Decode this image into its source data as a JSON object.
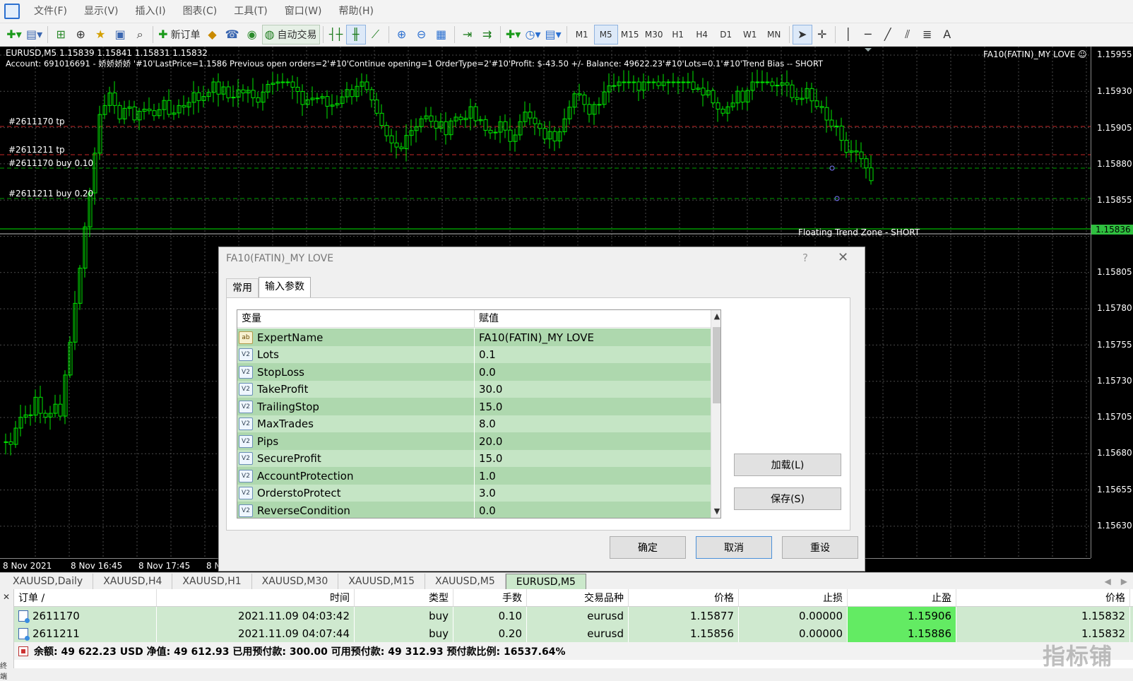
{
  "menu": [
    "文件(F)",
    "显示(V)",
    "插入(I)",
    "图表(C)",
    "工具(T)",
    "窗口(W)",
    "帮助(H)"
  ],
  "toolbar": {
    "new_order_label": "新订单",
    "auto_trade_label": "自动交易",
    "timeframes": [
      "M1",
      "M5",
      "M15",
      "M30",
      "H1",
      "H4",
      "D1",
      "W1",
      "MN"
    ],
    "selected_timeframe": "M5"
  },
  "chart": {
    "header": "EURUSD,M5  1.15839 1.15841 1.15831 1.15832",
    "info": "Account: 691016691 - 娇娇娇娇 '#10'LastPrice=1.1586 Previous open orders=2'#10'Continue opening=1 OrderType=2'#10'Profit: $-43.50 +/-  Balance: 49622.23'#10'Lots=0.1'#10'Trend Bias -- SHORT",
    "ea_label": "FA10(FATIN)_MY LOVE ☺",
    "line_labels": [
      "#2611170 tp",
      "#2611211 tp",
      "#2611170 buy 0.10",
      "#2611211 buy 0.20"
    ],
    "floating_label": "Floating Trend Zone - SHORT",
    "price_labels": [
      "1.15955",
      "1.15930",
      "1.15905",
      "1.15880",
      "1.15855",
      "1.15805",
      "1.15780",
      "1.15755",
      "1.15730",
      "1.15705",
      "1.15680",
      "1.15655",
      "1.15630"
    ],
    "current_price": "1.15836",
    "time_labels": [
      "8 Nov 2021",
      "8 Nov 16:45",
      "8 Nov 17:45",
      "8 N"
    ],
    "colors": {
      "candle": "#00e600",
      "tp_line": "#c62828",
      "entry_line": "#00a000",
      "background": "#000000"
    }
  },
  "dialog": {
    "title": "FA10(FATIN)_MY LOVE",
    "help": "?",
    "close": "✕",
    "tabs": [
      "常用",
      "输入参数"
    ],
    "active_tab": "输入参数",
    "columns": [
      "变量",
      "赋值"
    ],
    "params": [
      {
        "type": "ab",
        "name": "ExpertName",
        "value": "FA10(FATIN)_MY LOVE"
      },
      {
        "type": "v2",
        "name": "Lots",
        "value": "0.1"
      },
      {
        "type": "v2",
        "name": "StopLoss",
        "value": "0.0"
      },
      {
        "type": "v2",
        "name": "TakeProfit",
        "value": "30.0"
      },
      {
        "type": "v2",
        "name": "TrailingStop",
        "value": "15.0"
      },
      {
        "type": "v2",
        "name": "MaxTrades",
        "value": "8.0"
      },
      {
        "type": "v2",
        "name": "Pips",
        "value": "20.0"
      },
      {
        "type": "v2",
        "name": "SecureProfit",
        "value": "15.0"
      },
      {
        "type": "v2",
        "name": "AccountProtection",
        "value": "1.0"
      },
      {
        "type": "v2",
        "name": "OrderstoProtect",
        "value": "3.0"
      },
      {
        "type": "v2",
        "name": "ReverseCondition",
        "value": "0.0"
      }
    ],
    "load_button": "加载(L)",
    "save_button": "保存(S)",
    "ok_button": "确定",
    "cancel_button": "取消",
    "reset_button": "重设"
  },
  "chart_tabs": [
    "XAUUSD,Daily",
    "XAUUSD,H4",
    "XAUUSD,H1",
    "XAUUSD,M30",
    "XAUUSD,M15",
    "XAUUSD,M5",
    "EURUSD,M5"
  ],
  "active_chart_tab": "EURUSD,M5",
  "terminal": {
    "columns": [
      "订单 /",
      "时间",
      "类型",
      "手数",
      "交易品种",
      "价格",
      "止损",
      "止盈",
      "价格"
    ],
    "orders": [
      [
        "2611170",
        "2021.11.09 04:03:42",
        "buy",
        "0.10",
        "eurusd",
        "1.15877",
        "0.00000",
        "1.15906",
        "1.15832"
      ],
      [
        "2611211",
        "2021.11.09 04:07:44",
        "buy",
        "0.20",
        "eurusd",
        "1.15856",
        "0.00000",
        "1.15886",
        "1.15832"
      ]
    ],
    "summary": "余额: 49 622.23 USD  净值: 49 612.93  已用预付款: 300.00  可用预付款: 49 312.93  预付款比例: 16537.64%",
    "side_label": "终端"
  },
  "watermark": "指标铺"
}
